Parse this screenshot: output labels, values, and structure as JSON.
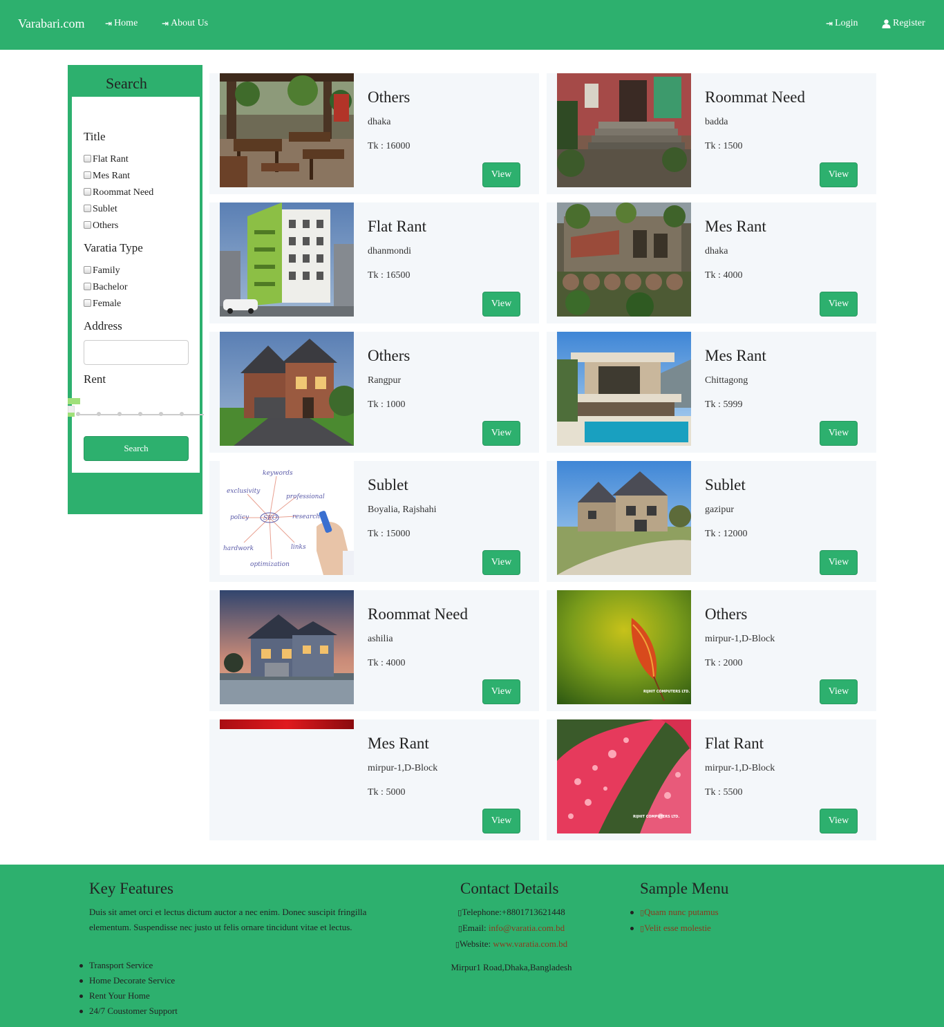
{
  "nav": {
    "brand": "Varabari.com",
    "home": "Home",
    "about": "About Us",
    "login": "Login",
    "register": "Register"
  },
  "sidebar": {
    "title": "Search",
    "title_group_label": "Title",
    "title_options": [
      "Flat Rant",
      "Mes Rant",
      "Roommat Need",
      "Sublet",
      "Others"
    ],
    "type_group_label": "Varatia Type",
    "type_options": [
      "Family",
      "Bachelor",
      "Female"
    ],
    "address_label": "Address",
    "address_value": "",
    "rent_label": "Rent",
    "search_button": "Search"
  },
  "listings": [
    {
      "title": "Others",
      "location": "dhaka",
      "price": "Tk : 16000",
      "button": "View",
      "image": "restaurant-patio"
    },
    {
      "title": "Roommat Need",
      "location": "badda",
      "price": "Tk : 1500",
      "button": "View",
      "image": "red-house-steps"
    },
    {
      "title": "Flat Rant",
      "location": "dhanmondi",
      "price": "Tk : 16500",
      "button": "View",
      "image": "apartment-building"
    },
    {
      "title": "Mes Rant",
      "location": "dhaka",
      "price": "Tk : 4000",
      "button": "View",
      "image": "old-ruins"
    },
    {
      "title": "Others",
      "location": "Rangpur",
      "price": "Tk : 1000",
      "button": "View",
      "image": "brick-house"
    },
    {
      "title": "Mes Rant",
      "location": "Chittagong",
      "price": "Tk : 5999",
      "button": "View",
      "image": "modern-villa-pool"
    },
    {
      "title": "Sublet",
      "location": "Boyalia, Rajshahi",
      "price": "Tk : 15000",
      "button": "View",
      "image": "seo-whiteboard"
    },
    {
      "title": "Sublet",
      "location": "gazipur",
      "price": "Tk : 12000",
      "button": "View",
      "image": "stone-house"
    },
    {
      "title": "Roommat Need",
      "location": "ashilia",
      "price": "Tk : 4000",
      "button": "View",
      "image": "house-dusk"
    },
    {
      "title": "Others",
      "location": "mirpur-1,D-Block",
      "price": "Tk : 2000",
      "button": "View",
      "image": "green-leaf"
    },
    {
      "title": "Mes Rant",
      "location": "mirpur-1,D-Block",
      "price": "Tk : 5000",
      "button": "View",
      "image": "broken-red-banner"
    },
    {
      "title": "Flat Rant",
      "location": "mirpur-1,D-Block",
      "price": "Tk : 5500",
      "button": "View",
      "image": "red-leaf-droplets"
    }
  ],
  "seo_words": {
    "keywords": "keywords",
    "exclusivity": "exclusivity",
    "professional": "professional",
    "policy": "policy",
    "seo": "SEO",
    "research": "research",
    "hardwork": "hardwork",
    "links": "links",
    "optimization": "optimization"
  },
  "watermark": "RIJHIT COMPUTERS LTD.",
  "footer": {
    "features_title": "Key Features",
    "features_text": "Duis sit amet orci et lectus dictum auctor a nec enim. Donec suscipit fringilla elementum. Suspendisse nec justo ut felis ornare tincidunt vitae et lectus.",
    "features_list": [
      "Transport Service",
      "Home Decorate Service",
      "Rent Your Home",
      "24/7 Coustomer Support"
    ],
    "contact_title": "Contact Details",
    "telephone": "Telephone:+8801713621448",
    "email_label": "Email:",
    "email_value": "info@varatia.com.bd",
    "website_label": "Website:",
    "website_value": "www.varatia.com.bd",
    "address": "Mirpur1 Road,Dhaka,Bangladesh",
    "menu_title": "Sample Menu",
    "menu_items": [
      "Quam nunc putamus",
      "Velit esse molestie"
    ]
  },
  "colors": {
    "brand_green": "#2db06e",
    "card_bg": "#f4f7fa",
    "link_brown": "#8a3b1f"
  }
}
